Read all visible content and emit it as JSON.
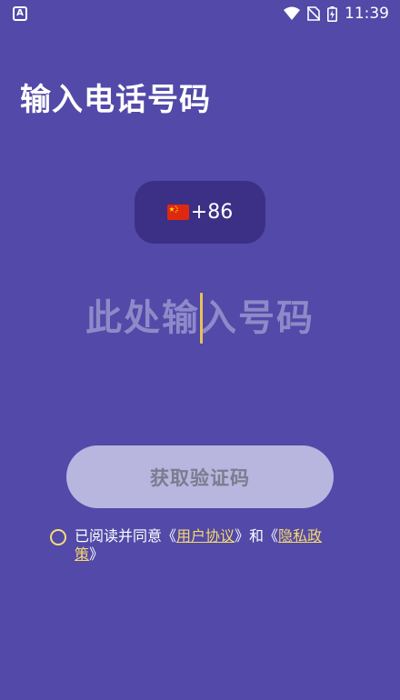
{
  "status_bar": {
    "app_icon_letter": "A",
    "time": "11:39"
  },
  "page": {
    "title": "输入电话号码"
  },
  "country_code": {
    "flag": "china-flag-icon",
    "code": "+86"
  },
  "phone_input": {
    "placeholder": "此处输入号码",
    "value": ""
  },
  "verify_button": {
    "label": "获取验证码"
  },
  "agreement": {
    "prefix": "已阅读并同意《",
    "user_agreement_link": "用户协议",
    "middle": "》和《",
    "privacy_link_part1": "隐私政",
    "privacy_link_part2": "策",
    "suffix": "》"
  },
  "colors": {
    "background": "#5249a8",
    "country_code_bg": "#3b2f86",
    "button_bg": "#b8b6de",
    "accent_yellow": "#f6d96b"
  }
}
